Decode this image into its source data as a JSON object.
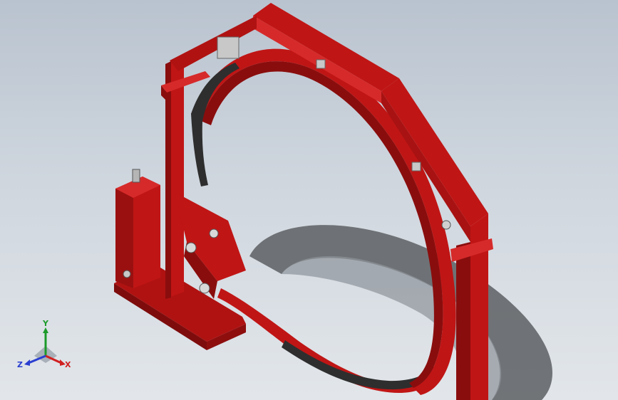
{
  "viewport": {
    "background_top": "#b9c3cf",
    "background_bottom": "#e2e6ea"
  },
  "model": {
    "body_color": "#c01515",
    "body_dark": "#8a0d0d",
    "body_light": "#d62a2a",
    "lining_color": "#2e2e2e",
    "shadow_color": "#5c5f63"
  },
  "triad": {
    "x_label": "X",
    "y_label": "Y",
    "z_label": "Z",
    "x_color": "#d02020",
    "y_color": "#1c9a2a",
    "z_color": "#2a3fd0"
  }
}
